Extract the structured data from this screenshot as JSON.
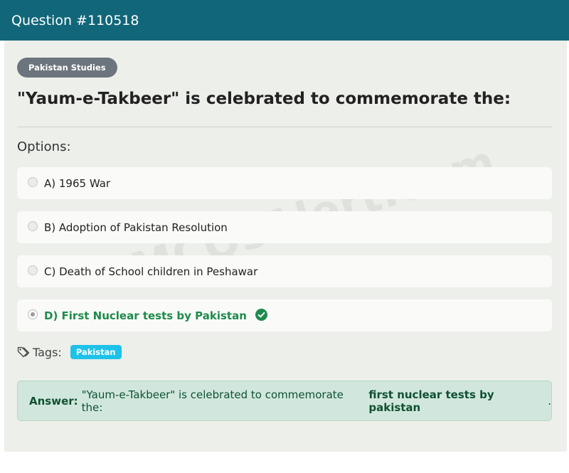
{
  "header": {
    "title": "Question #110518"
  },
  "question": {
    "category": "Pakistan Studies",
    "text": "\"Yaum-e-Takbeer\" is celebrated to commemorate the:",
    "options_heading": "Options:"
  },
  "options": [
    {
      "label": "A) 1965 War",
      "selected": false,
      "correct": false
    },
    {
      "label": "B) Adoption of Pakistan Resolution",
      "selected": false,
      "correct": false
    },
    {
      "label": "C) Death of School children in Peshawar",
      "selected": false,
      "correct": false
    },
    {
      "label": "D) First Nuclear tests by Pakistan",
      "selected": true,
      "correct": true
    }
  ],
  "tags": {
    "label": "Tags:",
    "items": [
      "Pakistan"
    ]
  },
  "answer": {
    "prefix": "Answer:",
    "question_text": "\"Yaum-e-Takbeer\" is celebrated to commemorate the:",
    "answer_text": "first nuclear tests by pakistan",
    "suffix": "."
  },
  "watermark": "MCQsAlert.com",
  "colors": {
    "header_bg": "#116679",
    "correct": "#1e8a4c",
    "answer_bg": "#d1e7dd",
    "tag_bg": "#1ec2e8",
    "badge_bg": "#6c757d"
  },
  "icons": {
    "check": "check-circle-icon",
    "tag": "tags-icon"
  }
}
